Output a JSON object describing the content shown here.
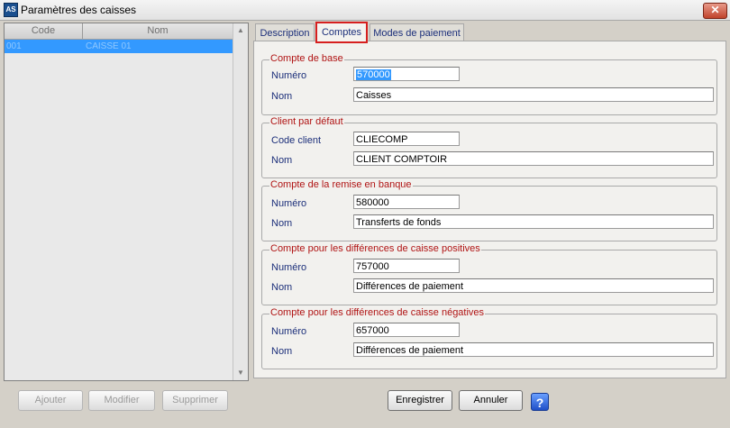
{
  "window": {
    "title": "Paramètres des caisses",
    "icon_label": "AS"
  },
  "list": {
    "columns": [
      "Code",
      "Nom"
    ],
    "rows": [
      {
        "code": "001",
        "nom": "CAISSE 01"
      }
    ]
  },
  "tabs": [
    "Description",
    "Comptes",
    "Modes de paiement"
  ],
  "active_tab": "Comptes",
  "groups": {
    "compte_base": {
      "title": "Compte de base",
      "numero_label": "Numéro",
      "numero": "570000",
      "nom_label": "Nom",
      "nom": "Caisses"
    },
    "client_defaut": {
      "title": "Client par défaut",
      "code_label": "Code client",
      "code": "CLIECOMP",
      "nom_label": "Nom",
      "nom": "CLIENT COMPTOIR"
    },
    "remise_banque": {
      "title": "Compte de la remise en banque",
      "numero_label": "Numéro",
      "numero": "580000",
      "nom_label": "Nom",
      "nom": "Transferts de fonds"
    },
    "diff_positives": {
      "title": "Compte pour les différences de caisse positives",
      "numero_label": "Numéro",
      "numero": "757000",
      "nom_label": "Nom",
      "nom": "Différences de paiement"
    },
    "diff_negatives": {
      "title": "Compte pour les différences de caisse négatives",
      "numero_label": "Numéro",
      "numero": "657000",
      "nom_label": "Nom",
      "nom": "Différences de paiement"
    }
  },
  "buttons": {
    "ajouter": "Ajouter",
    "modifier": "Modifier",
    "supprimer": "Supprimer",
    "enregistrer": "Enregistrer",
    "annuler": "Annuler",
    "help": "?"
  },
  "colors": {
    "selection": "#3399ff",
    "group_title": "#b01414",
    "label": "#1c2f7a",
    "active_tab_border": "#d61f1f"
  }
}
